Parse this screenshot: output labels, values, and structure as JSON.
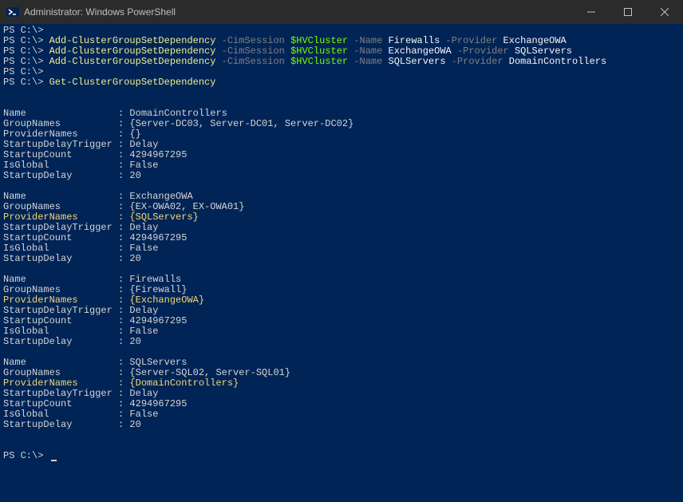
{
  "titlebar": {
    "title": "Administrator: Windows PowerShell"
  },
  "prompts": {
    "ps": "PS C:\\>"
  },
  "commands": [
    {
      "cmdlet": "Add-ClusterGroupSetDependency",
      "params": [
        {
          "name": "-CimSession",
          "value": "$HVCluster",
          "type": "var"
        },
        {
          "name": "-Name",
          "value": "Firewalls",
          "type": "arg"
        },
        {
          "name": "-Provider",
          "value": "ExchangeOWA",
          "type": "arg"
        }
      ]
    },
    {
      "cmdlet": "Add-ClusterGroupSetDependency",
      "params": [
        {
          "name": "-CimSession",
          "value": "$HVCluster",
          "type": "var"
        },
        {
          "name": "-Name",
          "value": "ExchangeOWA",
          "type": "arg"
        },
        {
          "name": "-Provider",
          "value": "SQLServers",
          "type": "arg"
        }
      ]
    },
    {
      "cmdlet": "Add-ClusterGroupSetDependency",
      "params": [
        {
          "name": "-CimSession",
          "value": "$HVCluster",
          "type": "var"
        },
        {
          "name": "-Name",
          "value": "SQLServers",
          "type": "arg"
        },
        {
          "name": "-Provider",
          "value": "DomainControllers",
          "type": "arg"
        }
      ]
    }
  ],
  "command2": {
    "cmdlet": "Get-ClusterGroupSetDependency"
  },
  "groups": [
    {
      "Name": "DomainControllers",
      "GroupNames": "{Server-DC03, Server-DC01, Server-DC02}",
      "ProviderNames": "{}",
      "ProviderHighlight": false,
      "StartupDelayTrigger": "Delay",
      "StartupCount": "4294967295",
      "IsGlobal": "False",
      "StartupDelay": "20"
    },
    {
      "Name": "ExchangeOWA",
      "GroupNames": "{EX-OWA02, EX-OWA01}",
      "ProviderNames": "{SQLServers}",
      "ProviderHighlight": true,
      "StartupDelayTrigger": "Delay",
      "StartupCount": "4294967295",
      "IsGlobal": "False",
      "StartupDelay": "20"
    },
    {
      "Name": "Firewalls",
      "GroupNames": "{Firewall}",
      "ProviderNames": "{ExchangeOWA}",
      "ProviderHighlight": true,
      "StartupDelayTrigger": "Delay",
      "StartupCount": "4294967295",
      "IsGlobal": "False",
      "StartupDelay": "20"
    },
    {
      "Name": "SQLServers",
      "GroupNames": "{Server-SQL02, Server-SQL01}",
      "ProviderNames": "{DomainControllers}",
      "ProviderHighlight": true,
      "StartupDelayTrigger": "Delay",
      "StartupCount": "4294967295",
      "IsGlobal": "False",
      "StartupDelay": "20"
    }
  ],
  "labels": {
    "Name": "Name",
    "GroupNames": "GroupNames",
    "ProviderNames": "ProviderNames",
    "StartupDelayTrigger": "StartupDelayTrigger",
    "StartupCount": "StartupCount",
    "IsGlobal": "IsGlobal",
    "StartupDelay": "StartupDelay"
  }
}
